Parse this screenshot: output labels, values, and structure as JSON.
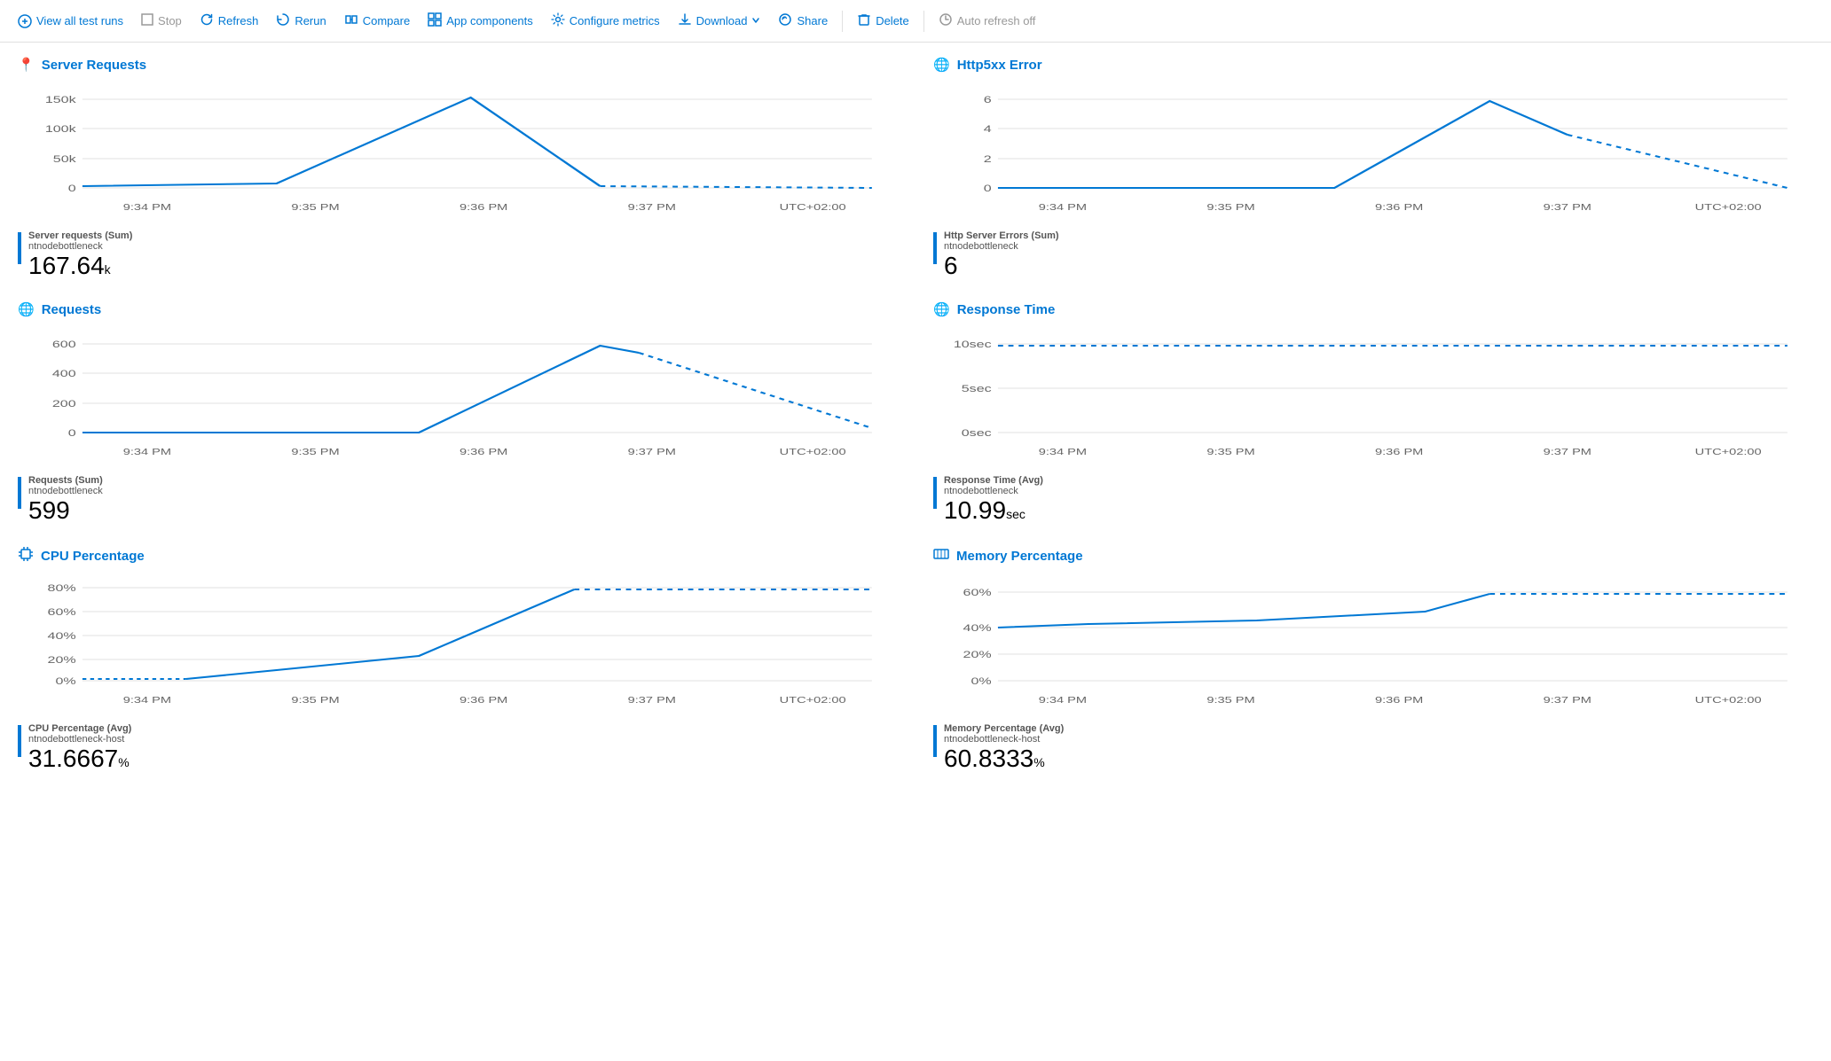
{
  "toolbar": {
    "view_all_label": "View all test runs",
    "stop_label": "Stop",
    "refresh_label": "Refresh",
    "rerun_label": "Rerun",
    "compare_label": "Compare",
    "app_components_label": "App components",
    "configure_metrics_label": "Configure metrics",
    "download_label": "Download",
    "share_label": "Share",
    "delete_label": "Delete",
    "auto_refresh_label": "Auto refresh off"
  },
  "charts": [
    {
      "id": "server-requests",
      "title": "Server Requests",
      "icon": "📍",
      "y_labels": [
        "150k",
        "100k",
        "50k",
        "0"
      ],
      "x_labels": [
        "9:34 PM",
        "9:35 PM",
        "9:36 PM",
        "9:37 PM",
        "UTC+02:00"
      ],
      "legend_label": "Server requests (Sum)",
      "legend_sublabel": "ntnodebottleneck",
      "value": "167.64",
      "value_unit": "k",
      "type": "line_up_down"
    },
    {
      "id": "http5xx-error",
      "title": "Http5xx Error",
      "icon": "🌐",
      "y_labels": [
        "6",
        "4",
        "2",
        "0"
      ],
      "x_labels": [
        "9:34 PM",
        "9:35 PM",
        "9:36 PM",
        "9:37 PM",
        "UTC+02:00"
      ],
      "legend_label": "Http Server Errors (Sum)",
      "legend_sublabel": "ntnodebottleneck",
      "value": "6",
      "value_unit": "",
      "type": "line_up_down_right"
    },
    {
      "id": "requests",
      "title": "Requests",
      "icon": "🌐",
      "y_labels": [
        "600",
        "400",
        "200",
        "0"
      ],
      "x_labels": [
        "9:34 PM",
        "9:35 PM",
        "9:36 PM",
        "9:37 PM",
        "UTC+02:00"
      ],
      "legend_label": "Requests (Sum)",
      "legend_sublabel": "ntnodebottleneck",
      "value": "599",
      "value_unit": "",
      "type": "line_up_down2"
    },
    {
      "id": "response-time",
      "title": "Response Time",
      "icon": "🌐",
      "y_labels": [
        "10sec",
        "5sec",
        "0sec"
      ],
      "x_labels": [
        "9:34 PM",
        "9:35 PM",
        "9:36 PM",
        "9:37 PM",
        "UTC+02:00"
      ],
      "legend_label": "Response Time (Avg)",
      "legend_sublabel": "ntnodebottleneck",
      "value": "10.99",
      "value_unit": "sec",
      "type": "flat_high"
    },
    {
      "id": "cpu-percentage",
      "title": "CPU Percentage",
      "icon": "📊",
      "y_labels": [
        "80%",
        "60%",
        "40%",
        "20%",
        "0%"
      ],
      "x_labels": [
        "9:34 PM",
        "9:35 PM",
        "9:36 PM",
        "9:37 PM",
        "UTC+02:00"
      ],
      "legend_label": "CPU Percentage (Avg)",
      "legend_sublabel": "ntnodebottleneck-host",
      "value": "31.6667",
      "value_unit": "%",
      "type": "cpu_line"
    },
    {
      "id": "memory-percentage",
      "title": "Memory Percentage",
      "icon": "📊",
      "y_labels": [
        "60%",
        "40%",
        "20%",
        "0%"
      ],
      "x_labels": [
        "9:34 PM",
        "9:35 PM",
        "9:36 PM",
        "9:37 PM",
        "UTC+02:00"
      ],
      "legend_label": "Memory Percentage (Avg)",
      "legend_sublabel": "ntnodebottleneck-host",
      "value": "60.8333",
      "value_unit": "%",
      "type": "memory_line"
    }
  ],
  "colors": {
    "accent": "#0078d4",
    "line_solid": "#0078d4",
    "line_dashed": "#0078d4",
    "grid": "#e0e0e0",
    "axis_text": "#666"
  }
}
